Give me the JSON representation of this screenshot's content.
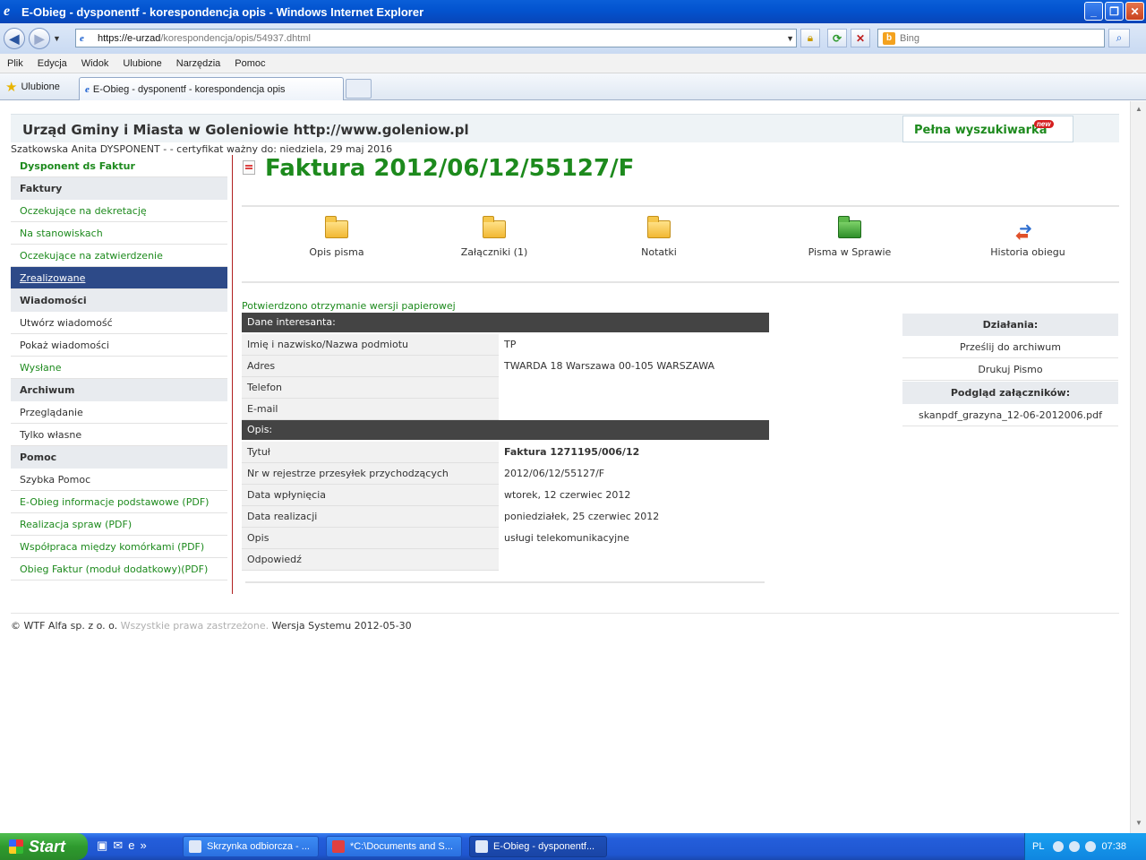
{
  "window": {
    "title": "E-Obieg - dysponentf - korespondencja opis - Windows Internet Explorer"
  },
  "address": {
    "url_host": "https://e-urzad",
    "url_path": "/korespondencja/opis/54937.dhtml",
    "search_placeholder": "Bing"
  },
  "menu": [
    "Plik",
    "Edycja",
    "Widok",
    "Ulubione",
    "Narzędzia",
    "Pomoc"
  ],
  "favorites_label": "Ulubione",
  "tab_title": "E-Obieg - dysponentf - korespondencja opis",
  "header": {
    "title": "Urząd Gminy i Miasta w Goleniowie http://www.goleniow.pl",
    "search_link": "Pełna wyszukiwarka",
    "new_badge": "new"
  },
  "user_line": "Szatkowska Anita DYSPONENT - - certyfikat ważny do: niedziela, 29 maj 2016",
  "sidebar": {
    "title": "Dysponent ds Faktur",
    "sections": [
      {
        "label": "Faktury",
        "items": [
          {
            "label": "Oczekujące na dekretację",
            "style": "link"
          },
          {
            "label": "Na stanowiskach",
            "style": "link"
          },
          {
            "label": "Oczekujące na zatwierdzenie",
            "style": "link"
          },
          {
            "label": "Zrealizowane",
            "style": "active"
          }
        ]
      },
      {
        "label": "Wiadomości",
        "items": [
          {
            "label": "Utwórz wiadomość",
            "style": "plain"
          },
          {
            "label": "Pokaż wiadomości",
            "style": "plain"
          },
          {
            "label": "Wysłane",
            "style": "link"
          }
        ]
      },
      {
        "label": "Archiwum",
        "items": [
          {
            "label": "Przeglądanie",
            "style": "plain"
          },
          {
            "label": "Tylko własne",
            "style": "plain"
          }
        ]
      },
      {
        "label": "Pomoc",
        "items": [
          {
            "label": "Szybka Pomoc",
            "style": "plain"
          },
          {
            "label": "E-Obieg informacje podstawowe (PDF)",
            "style": "link"
          },
          {
            "label": "Realizacja spraw (PDF)",
            "style": "link"
          },
          {
            "label": "Współpraca między komórkami (PDF)",
            "style": "link"
          },
          {
            "label": "Obieg Faktur (moduł dodatkowy)(PDF)",
            "style": "link"
          }
        ]
      }
    ]
  },
  "main": {
    "title": "Faktura 2012/06/12/55127/F",
    "actions": [
      {
        "label": "Opis pisma",
        "icon": "folder-icon"
      },
      {
        "label": "Załączniki (1)",
        "icon": "folder-attachment-icon"
      },
      {
        "label": "Notatki",
        "icon": "notes-folder-icon"
      },
      {
        "label": "Pisma w Sprawie",
        "icon": "green-folder-icon"
      },
      {
        "label": "Historia obiegu",
        "icon": "history-arrows-icon"
      }
    ],
    "confirm_text": "Potwierdzono otrzymanie wersji papierowej",
    "interesant": {
      "header": "Dane interesanta:",
      "rows": [
        {
          "label": "Imię i nazwisko/Nazwa podmiotu",
          "value": "TP"
        },
        {
          "label": "Adres",
          "value": "TWARDA 18 Warszawa 00-105 WARSZAWA"
        },
        {
          "label": "Telefon",
          "value": ""
        },
        {
          "label": "E-mail",
          "value": ""
        }
      ]
    },
    "opis": {
      "header": "Opis:",
      "rows": [
        {
          "label": "Tytuł",
          "value": "Faktura 1271195/006/12"
        },
        {
          "label": "Nr w rejestrze przesyłek przychodzących",
          "value": "2012/06/12/55127/F"
        },
        {
          "label": "Data wpłynięcia",
          "value": "wtorek, 12 czerwiec 2012"
        },
        {
          "label": "Data realizacji",
          "value": "poniedziałek, 25 czerwiec 2012"
        },
        {
          "label": "Opis",
          "value": "usługi telekomunikacyjne"
        },
        {
          "label": "Odpowiedź",
          "value": ""
        }
      ]
    }
  },
  "right_panel": {
    "actions_header": "Działania:",
    "actions": [
      "Prześlij do archiwum",
      "Drukuj Pismo"
    ],
    "attachments_header": "Podgląd załączników:",
    "attachments": [
      "skanpdf_grazyna_12-06-2012006.pdf"
    ]
  },
  "footer": {
    "company": "© WTF Alfa sp. z o. o.",
    "rights": "Wszystkie prawa zastrzeżone.",
    "version": "Wersja Systemu 2012-05-30"
  },
  "taskbar": {
    "start": "Start",
    "tasks": [
      {
        "label": "Skrzynka odbiorcza - ...",
        "active": false
      },
      {
        "label": "*C:\\Documents and S...",
        "active": false
      },
      {
        "label": "E-Obieg - dysponentf...",
        "active": true
      }
    ],
    "lang": "PL",
    "clock": "07:38"
  }
}
